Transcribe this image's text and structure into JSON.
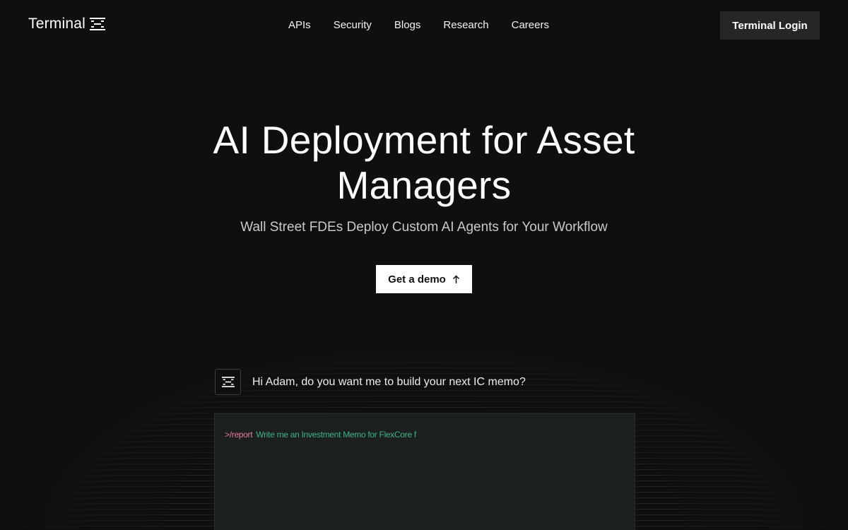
{
  "header": {
    "logo_text": "Terminal",
    "nav": [
      {
        "label": "APIs"
      },
      {
        "label": "Security"
      },
      {
        "label": "Blogs"
      },
      {
        "label": "Research"
      },
      {
        "label": "Careers"
      }
    ],
    "login_label": "Terminal Login"
  },
  "hero": {
    "title_line1": "AI Deployment for Asset",
    "title_line2": "Managers",
    "subtitle": "Wall Street FDEs Deploy Custom AI Agents for Your Workflow",
    "cta_label": "Get a demo",
    "cta_icon": "arrow-up-icon"
  },
  "chat": {
    "agent_icon": "terminal-logo-icon",
    "message": "Hi Adam, do you want me to build your next IC memo?",
    "prompt_command": ">/report",
    "prompt_text": "Write me an Investment Memo for FlexCore f"
  },
  "colors": {
    "background": "#0e0f0f",
    "login_button": "#242627",
    "panel": "#1c1f20",
    "command": "#e07a9a",
    "prompt_text": "#3fb37f"
  }
}
